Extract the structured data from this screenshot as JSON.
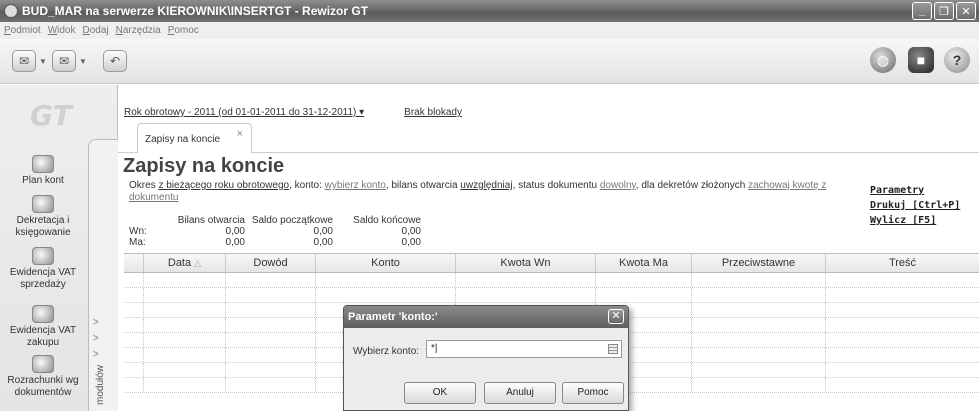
{
  "window": {
    "title": "BUD_MAR na serwerze KIEROWNIK\\INSERTGT - Rewizor GT",
    "minimize": "_",
    "maximize": "❐",
    "close": "✕"
  },
  "menu": [
    "Podmiot",
    "Widok",
    "Dodaj",
    "Narzędzia",
    "Pomoc"
  ],
  "toolbar_icons": [
    "back-icon",
    "forward-icon",
    "undo-icon",
    "globe-icon",
    "cube-icon",
    "help-icon"
  ],
  "left_panel": {
    "logo": "GT",
    "modules": [
      "Plan kont",
      "Dekretacja i księgowanie",
      "Ewidencja VAT sprzedaży",
      "Ewidencja VAT zakupu",
      "Rozrachunki wg dokumentów"
    ],
    "vertical_label": "modułów"
  },
  "main": {
    "year_link": "Rok obrotowy - 2011  (od 01-01-2011 do 31-12-2011) ▾",
    "lock_link": "Brak blokady",
    "tab_label": "Zapisy na koncie",
    "title": "Zapisy na koncie",
    "desc": {
      "t1": "Okres ",
      "l1": "z bieżącego roku obrotowego",
      "t2": ", konto: ",
      "l2": "wybierz konto",
      "t3": ", bilans otwarcia ",
      "l3": "uwzględniaj",
      "t4": ", status dokumentu ",
      "l4": "dowolny",
      "t5": ", dla dekretów złożonych ",
      "l5": "zachowaj kwotę z dokumentu"
    },
    "side_links": [
      "Parametry",
      "Drukuj [Ctrl+P]",
      "Wylicz [F5]"
    ],
    "balances": {
      "headers": [
        "Bilans otwarcia",
        "Saldo początkowe",
        "Saldo końcowe"
      ],
      "wn": {
        "label": "Wn:",
        "values": [
          "0,00",
          "0,00",
          "0,00"
        ]
      },
      "ma": {
        "label": "Ma:",
        "values": [
          "0,00",
          "0,00",
          "0,00"
        ]
      }
    },
    "grid_columns": [
      "Data",
      "Dowód",
      "Konto",
      "Kwota Wn",
      "Kwota Ma",
      "Przeciwstawne",
      "Treść"
    ]
  },
  "dialog": {
    "title": "Parametr 'konto:'",
    "label": "Wybierz konto:",
    "value": "*|",
    "ok": "OK",
    "cancel": "Anuluj",
    "help": "Pomoc"
  }
}
